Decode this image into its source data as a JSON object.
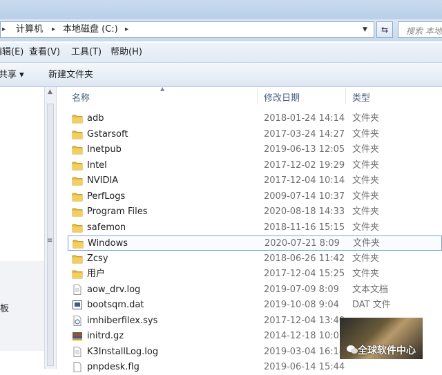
{
  "address": {
    "crumbs": [
      "计算机",
      "本地磁盘 (C:)"
    ],
    "search_placeholder": "搜索 本地"
  },
  "menu": [
    "编辑(E)",
    "查看(V)",
    "工具(T)",
    "帮助(H)"
  ],
  "commands": {
    "share": "共享 ▾",
    "new_folder": "新建文件夹"
  },
  "columns": {
    "name": "名称",
    "date": "修改日期",
    "type": "类型"
  },
  "nav": {
    "label": "板"
  },
  "files": [
    {
      "name": "adb",
      "date": "2018-01-24 14:14",
      "type": "文件夹",
      "icon": "folder-icon"
    },
    {
      "name": "Gstarsoft",
      "date": "2017-03-24 14:27",
      "type": "文件夹",
      "icon": "folder-icon"
    },
    {
      "name": "Inetpub",
      "date": "2019-06-13 12:05",
      "type": "文件夹",
      "icon": "folder-icon"
    },
    {
      "name": "Intel",
      "date": "2017-12-02 19:29",
      "type": "文件夹",
      "icon": "folder-icon"
    },
    {
      "name": "NVIDIA",
      "date": "2017-12-04 10:14",
      "type": "文件夹",
      "icon": "folder-icon"
    },
    {
      "name": "PerfLogs",
      "date": "2009-07-14 10:37",
      "type": "文件夹",
      "icon": "folder-icon"
    },
    {
      "name": "Program Files",
      "date": "2020-08-18 14:33",
      "type": "文件夹",
      "icon": "folder-icon"
    },
    {
      "name": "safemon",
      "date": "2018-11-16 15:15",
      "type": "文件夹",
      "icon": "folder-icon"
    },
    {
      "name": "Windows",
      "date": "2020-07-21 8:09",
      "type": "文件夹",
      "icon": "folder-icon",
      "selected": true
    },
    {
      "name": "Zcsy",
      "date": "2018-06-26 11:42",
      "type": "文件夹",
      "icon": "folder-icon"
    },
    {
      "name": "用户",
      "date": "2017-12-04 15:25",
      "type": "文件夹",
      "icon": "folder-icon"
    },
    {
      "name": "aow_drv.log",
      "date": "2019-07-09 8:09",
      "type": "文本文档",
      "icon": "text-file-icon"
    },
    {
      "name": "bootsqm.dat",
      "date": "2019-10-08 9:04",
      "type": "DAT 文件",
      "icon": "dat-file-icon"
    },
    {
      "name": "imhiberfilex.sys",
      "date": "2017-12-04 13:40",
      "type": "",
      "icon": "system-file-icon"
    },
    {
      "name": "initrd.gz",
      "date": "2014-12-18 10:07",
      "type": "",
      "icon": "archive-icon"
    },
    {
      "name": "K3InstallLog.log",
      "date": "2019-03-04 16:14",
      "type": "",
      "icon": "text-file-icon"
    },
    {
      "name": "pnpdesk.flg",
      "date": "2019-06-14 15:44",
      "type": "",
      "icon": "file-icon"
    }
  ],
  "watermark": {
    "text": "全球软件中心"
  },
  "colors": {
    "folder": "#e8b93a",
    "selection_border": "#7da2ce",
    "header_text": "#4c607a"
  }
}
